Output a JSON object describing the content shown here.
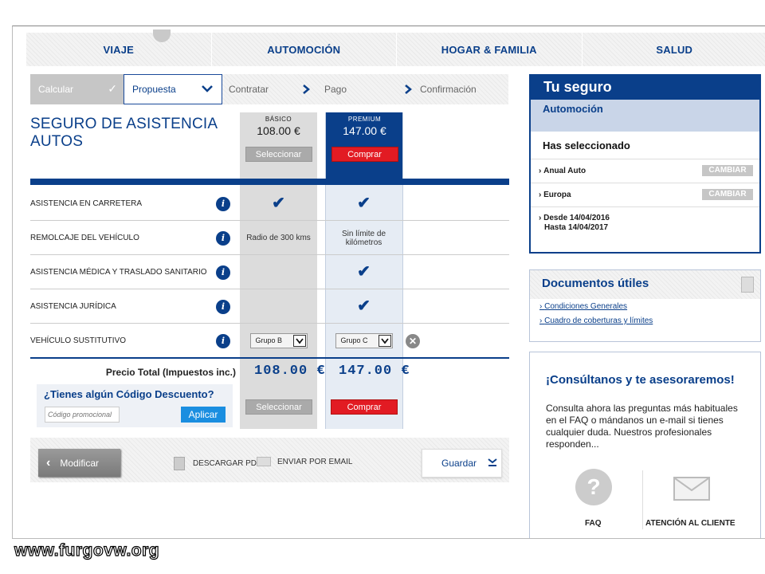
{
  "nav": {
    "tabs": [
      "VIAJE",
      "AUTOMOCIÓN",
      "HOGAR & FAMILIA",
      "SALUD"
    ]
  },
  "steps": {
    "calcular": "Calcular",
    "propuesta": "Propuesta",
    "contratar": "Contratar",
    "pago": "Pago",
    "confirmacion": "Confirmación"
  },
  "page": {
    "title_line1": "SEGURO DE ASISTENCIA",
    "title_line2": "AUTOS"
  },
  "plans": {
    "basic": {
      "name": "BÁSICO",
      "price": "108.00 €",
      "button": "Seleccionar"
    },
    "premium": {
      "name": "PREMIUM",
      "price": "147.00 €",
      "button": "Comprar"
    }
  },
  "coverage": [
    {
      "label": "ASISTENCIA EN CARRETERA",
      "basic": "check",
      "premium": "check"
    },
    {
      "label": "REMOLCAJE DEL VEHÍCULO",
      "basic": "Radio de 300 kms",
      "premium": "Sin límite de kilómetros"
    },
    {
      "label": "ASISTENCIA MÉDICA Y TRASLADO SANITARIO",
      "basic": "",
      "premium": "check"
    },
    {
      "label": "ASISTENCIA JURÍDICA",
      "basic": "",
      "premium": "check"
    },
    {
      "label": "VEHÍCULO SUSTITUTIVO",
      "basic": "Grupo B",
      "premium": "Grupo C"
    }
  ],
  "info_glyph": "i",
  "total": {
    "label": "Precio Total (Impuestos inc.)",
    "basic": "108.00 €",
    "premium": "147.00 €"
  },
  "discount": {
    "title": "¿Tienes algún Código Descuento?",
    "placeholder": "Código promocional",
    "apply": "Aplicar"
  },
  "footer": {
    "modify": "Modificar",
    "pdf": "DESCARGAR PDF",
    "email": "ENVIAR POR EMAIL",
    "save": "Guardar"
  },
  "summary": {
    "title": "Tu seguro",
    "section": "Automoción",
    "selected_title": "Has seleccionado",
    "items": [
      {
        "label": "Anual Auto",
        "button": "CAMBIAR"
      },
      {
        "label": "Europa",
        "button": "CAMBIAR"
      }
    ],
    "from": "Desde  14/04/2016",
    "to": "Hasta  14/04/2017"
  },
  "docs": {
    "title": "Documentos útiles",
    "links": [
      "Condiciones Generales",
      "Cuadro de coberturas y límites"
    ]
  },
  "help": {
    "title": "¡Consúltanos y te asesoraremos!",
    "text": "Consulta ahora las preguntas más habituales en el FAQ o mándanos un e-mail si tienes cualquier duda. Nuestros profesionales responden...",
    "faq": "FAQ",
    "customer": "ATENCIÓN AL CLIENTE"
  },
  "watermark": "www.furgovw.org",
  "colors": {
    "brand_blue": "#0a3f8a",
    "buy_red": "#e21b23",
    "apply_blue": "#1a8ee0"
  }
}
